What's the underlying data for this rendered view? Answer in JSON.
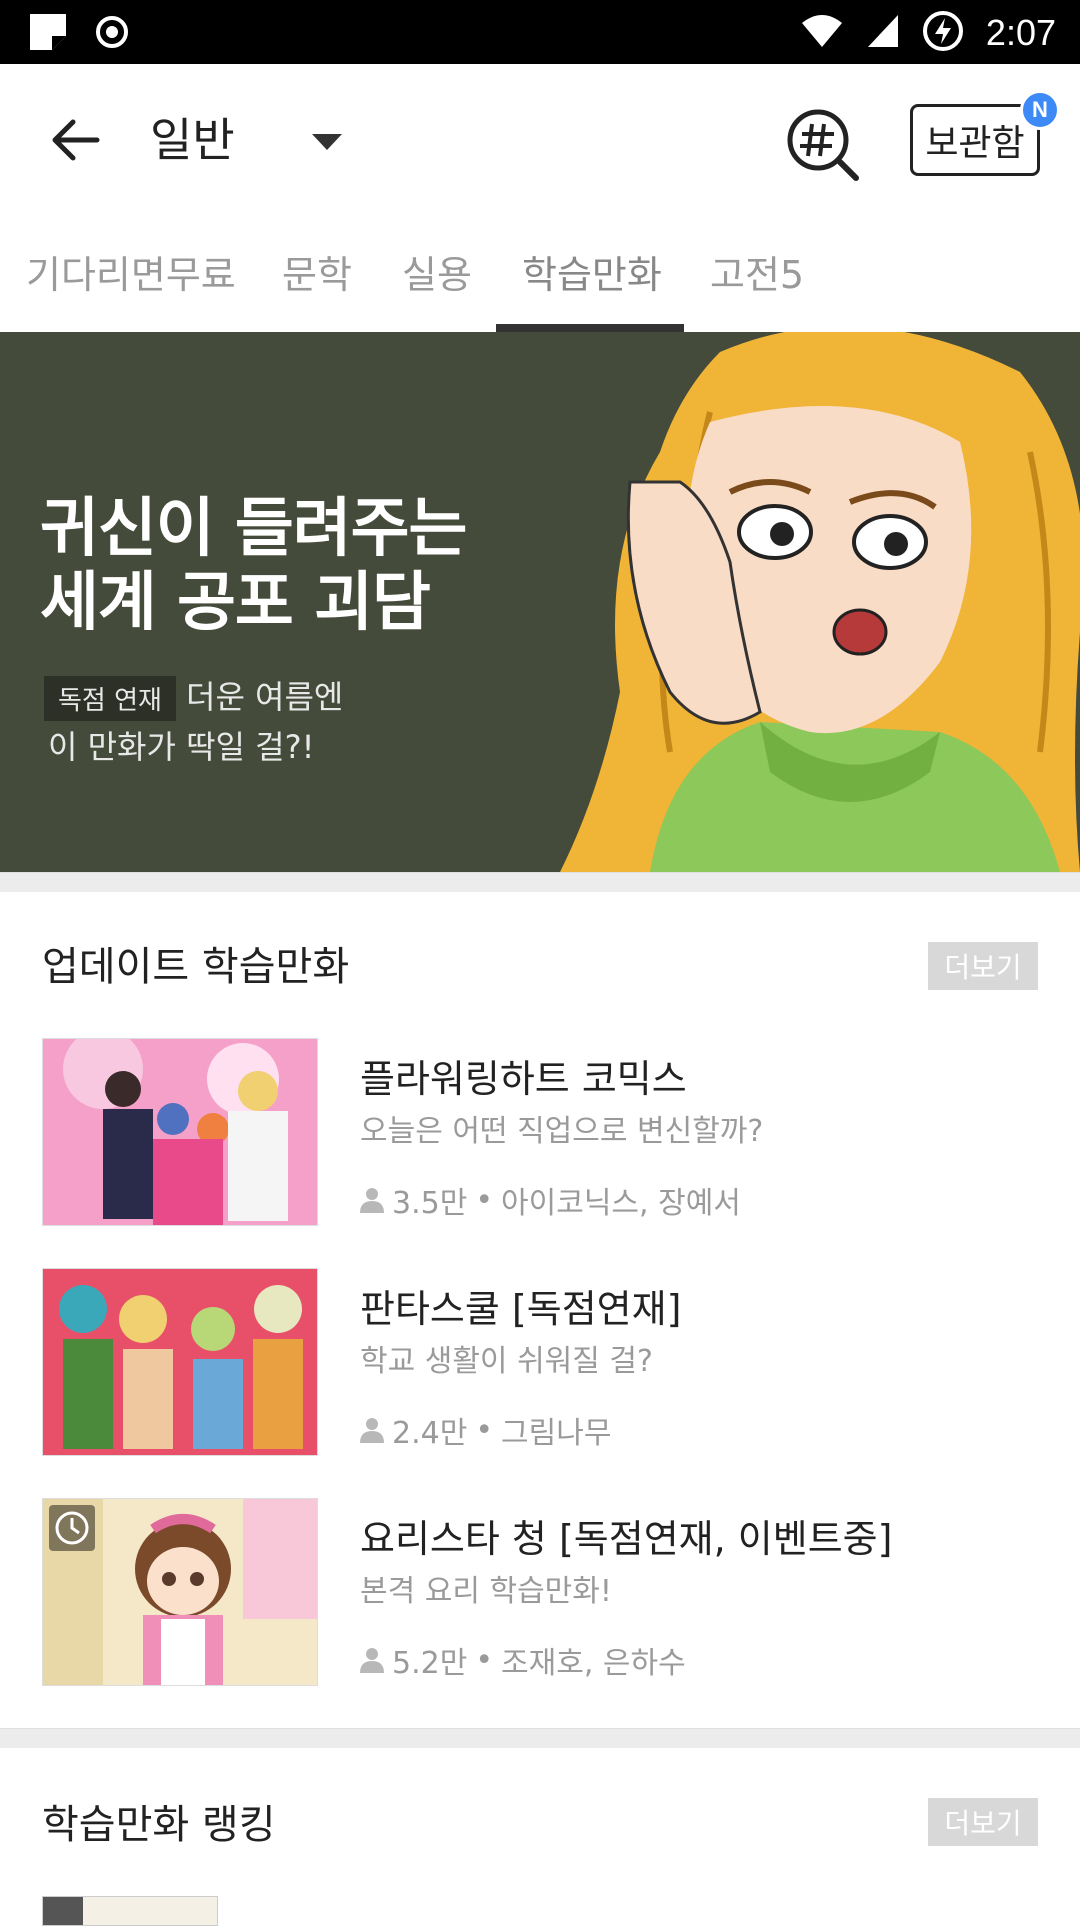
{
  "status_bar": {
    "time": "2:07",
    "icons": [
      "notification-icon",
      "record-icon",
      "wifi-icon",
      "signal-icon",
      "battery-charging-icon"
    ]
  },
  "header": {
    "title": "일반",
    "storage_label": "보관함",
    "new_badge": "N"
  },
  "tabs": [
    {
      "label": "기다리면무료",
      "active": false
    },
    {
      "label": "문학",
      "active": false
    },
    {
      "label": "실용",
      "active": false
    },
    {
      "label": "학습만화",
      "active": true
    },
    {
      "label": "고전5",
      "active": false
    }
  ],
  "banner": {
    "title_line1": "귀신이 들려주는",
    "title_line2": "세계 공포 괴담",
    "tag": "독점 연재",
    "subtitle_line1": "더운 여름엔",
    "subtitle_line2": "이 만화가 딱일 걸?!",
    "background": "#454b3a"
  },
  "update_section": {
    "title": "업데이트 학습만화",
    "more_label": "더보기",
    "items": [
      {
        "title": "플라워링하트 코믹스",
        "description": "오늘은 어떤 직업으로 변신할까?",
        "views": "3.5만",
        "authors": "아이코닉스, 장예서"
      },
      {
        "title": "판타스쿨 [독점연재]",
        "description": "학교 생활이 쉬워질 걸?",
        "views": "2.4만",
        "authors": "그림나무"
      },
      {
        "title": "요리스타 청 [독점연재, 이벤트중]",
        "description": "본격 요리 학습만화!",
        "views": "5.2만",
        "authors": "조재호, 은하수"
      }
    ]
  },
  "ranking_section": {
    "title": "학습만화 랭킹",
    "more_label": "더보기"
  },
  "meta_separator": "•",
  "accent_color": "#3d8af7"
}
